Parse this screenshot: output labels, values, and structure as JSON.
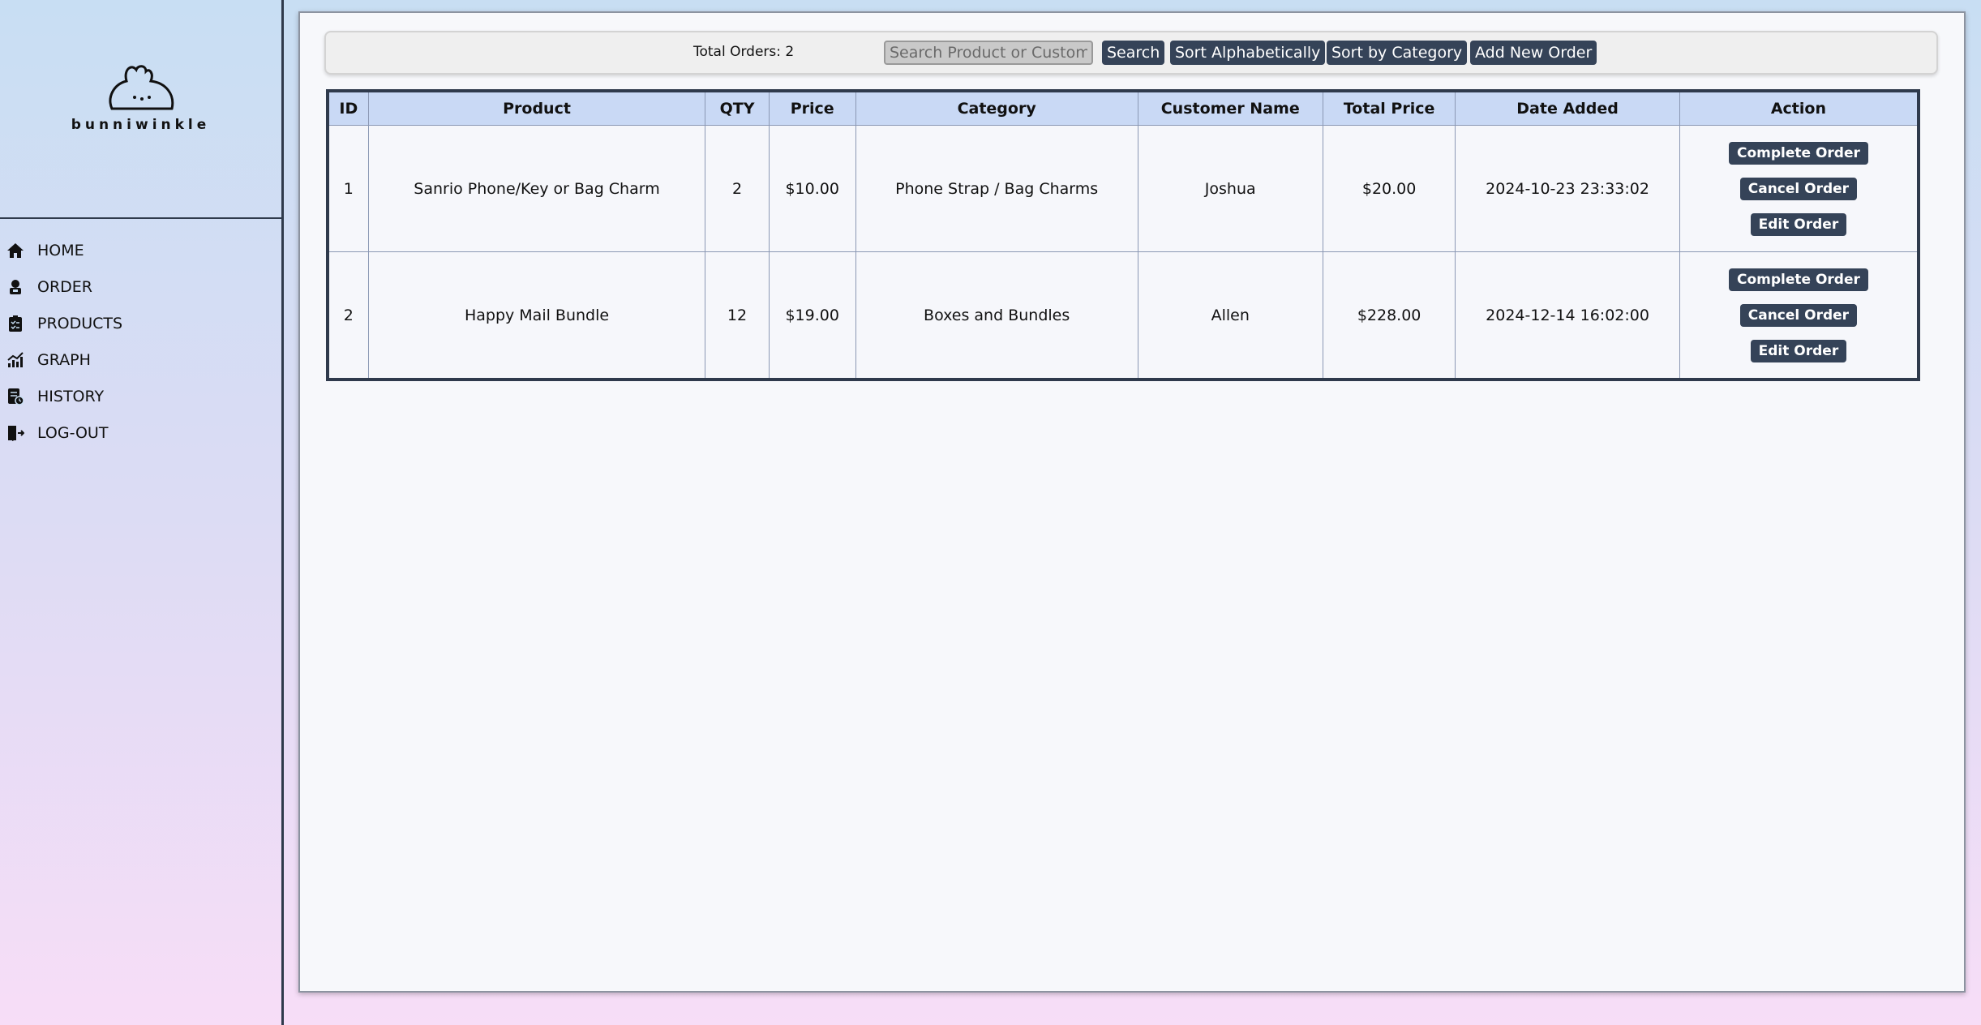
{
  "brand": {
    "name": "bunniwinkle"
  },
  "sidebar": {
    "items": [
      {
        "label": "HOME",
        "icon": "home-icon"
      },
      {
        "label": "ORDER",
        "icon": "order-icon"
      },
      {
        "label": "PRODUCTS",
        "icon": "products-icon"
      },
      {
        "label": "GRAPH",
        "icon": "graph-icon"
      },
      {
        "label": "HISTORY",
        "icon": "history-icon"
      },
      {
        "label": "LOG-OUT",
        "icon": "logout-icon"
      }
    ]
  },
  "toolbar": {
    "total_orders": "Total Orders: 2",
    "search_placeholder": "Search Product or Customer",
    "search_label": "Search",
    "sort_alpha_label": "Sort Alphabetically",
    "sort_category_label": "Sort by Category",
    "add_order_label": "Add New Order"
  },
  "table": {
    "headers": [
      "ID",
      "Product",
      "QTY",
      "Price",
      "Category",
      "Customer Name",
      "Total Price",
      "Date Added",
      "Action"
    ],
    "rows": [
      {
        "id": "1",
        "product": "Sanrio Phone/Key or Bag Charm",
        "qty": "2",
        "price": "$10.00",
        "category": "Phone Strap / Bag Charms",
        "customer": "Joshua",
        "total": "$20.00",
        "date": "2024-10-23 23:33:02"
      },
      {
        "id": "2",
        "product": "Happy Mail Bundle",
        "qty": "12",
        "price": "$19.00",
        "category": "Boxes and Bundles",
        "customer": "Allen",
        "total": "$228.00",
        "date": "2024-12-14 16:02:00"
      }
    ],
    "actions": {
      "complete": "Complete Order",
      "cancel": "Cancel Order",
      "edit": "Edit Order"
    }
  },
  "colors": {
    "accent": "#354358",
    "header_bg": "#c9d9f5",
    "border": "#2f3a4c"
  }
}
